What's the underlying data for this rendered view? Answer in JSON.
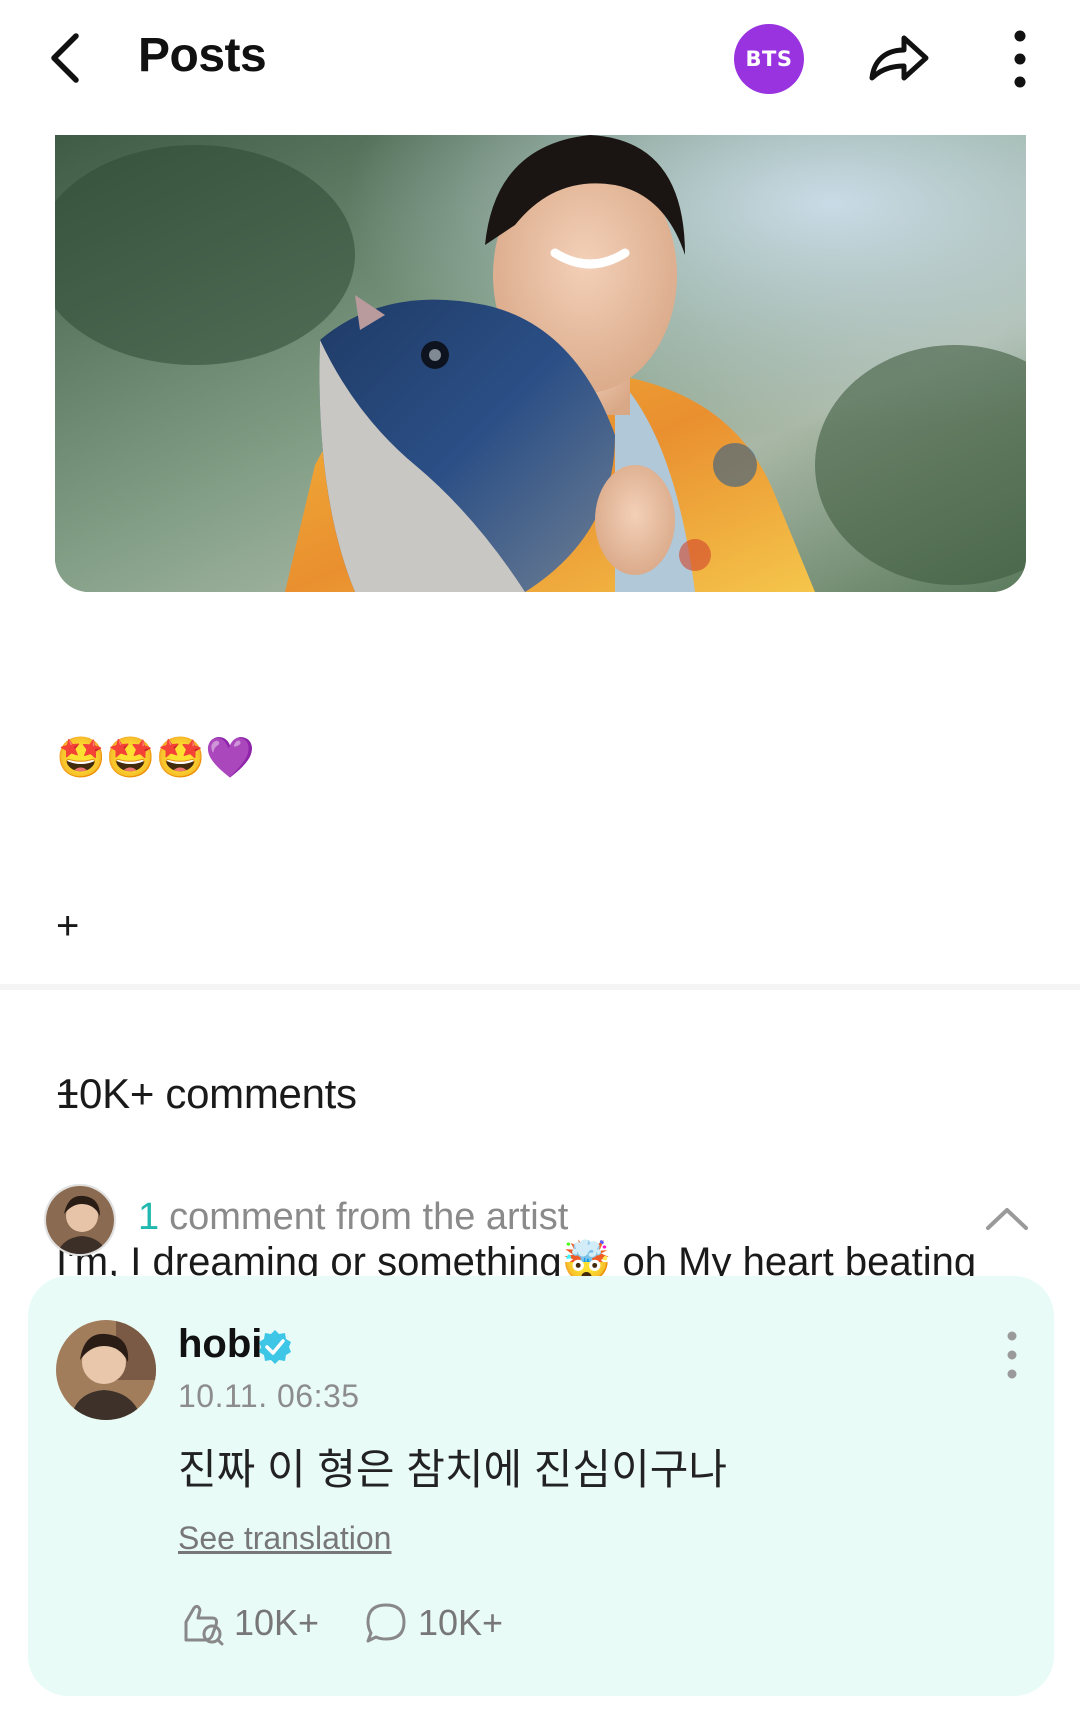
{
  "header": {
    "title": "Posts",
    "community_badge": "BTS",
    "badge_color": "#9933e0"
  },
  "post": {
    "body_line1": "🤩🤩🤩💜",
    "body_line2": "+",
    "body_line3": "+",
    "body_line4": "I'm, I dreaming or something🤯 oh My heart beating so fast.....Hobi Oppaa😍"
  },
  "comments": {
    "count_label": "10K+ comments",
    "artist_count": "1",
    "artist_label": "comment from the artist",
    "accent_color": "#21b8b0"
  },
  "artist_comment": {
    "name": "hobi",
    "time": "10.11. 06:35",
    "text": "진짜 이 형은 참치에 진심이구나",
    "translate_label": "See translation",
    "likes": "10K+",
    "replies": "10K+",
    "card_color": "#e9fbf7"
  },
  "icons": {
    "back": "back-arrow-icon",
    "share": "share-icon",
    "more": "more-vertical-icon",
    "chevron": "chevron-up-icon",
    "verified": "verified-badge-icon",
    "like": "like-icon",
    "reply": "reply-icon"
  }
}
